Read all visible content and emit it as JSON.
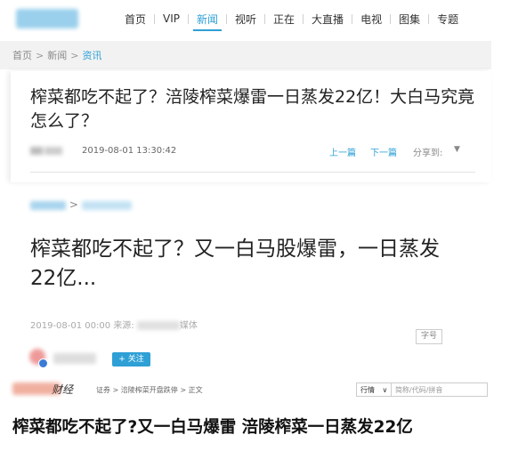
{
  "nav": {
    "items": [
      "首页",
      "VIP",
      "新闻",
      "视听",
      "正在",
      "大直播",
      "电视",
      "图集",
      "专题"
    ],
    "active_index": 2,
    "accent": "#2ea0d6"
  },
  "crumb1": {
    "home": "首页",
    "news": "新闻",
    "current": "资讯",
    "sep": ">"
  },
  "article1": {
    "title": "榨菜都吃不起了？涪陵榨菜爆雷一日蒸发22亿！大白马究竟怎么了？",
    "date": "2019-08-01 13:30:42",
    "prev": "上一篇",
    "next": "下一篇",
    "share": "分享到:",
    "share_caret": "▼"
  },
  "article2": {
    "crumb_sep": ">",
    "title": "榨菜都吃不起了？又一白马股爆雷，一日蒸发22亿...",
    "date": "2019-08-01 00:00",
    "source_label": "来源:",
    "source_suffix": "媒体",
    "font_size_btn": "字号",
    "follow": "+ 关注"
  },
  "article3": {
    "brand": "财经",
    "crumb": "证券 > 涪陵榨菜开盘跌停 > 正文",
    "quote_select": "行情",
    "quote_caret": "∨",
    "quote_placeholder": "简称/代码/拼音",
    "title": "榨菜都吃不起了?又一白马爆雷 涪陵榨菜一日蒸发22亿"
  }
}
